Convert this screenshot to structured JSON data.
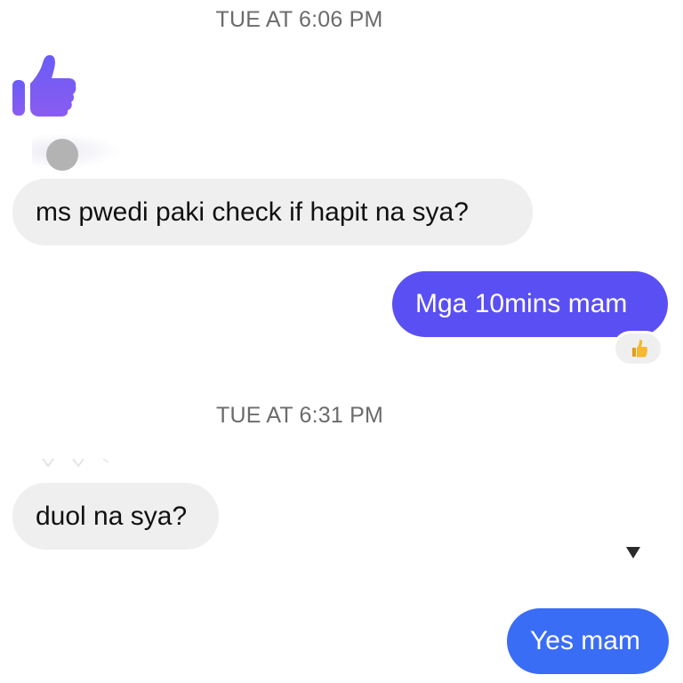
{
  "timestamps": {
    "first": "TUE AT 6:06 PM",
    "second": "TUE AT 6:31 PM"
  },
  "messages": [
    {
      "direction": "incoming",
      "text": "ms pwedi paki check if hapit na sya?"
    },
    {
      "direction": "outgoing",
      "text": "Mga 10mins mam"
    },
    {
      "direction": "incoming",
      "text": "duol na sya?"
    },
    {
      "direction": "outgoing",
      "text": "Yes mam"
    }
  ],
  "icons": {
    "big_like": "thumbs-up-icon",
    "reaction": "thumbs-up-emoji-icon",
    "seen": "seen-indicator-icon",
    "avatar": "avatar"
  },
  "colors": {
    "like": "#7b5cf5",
    "outgoing_purple": "#5a4ff3",
    "outgoing_blue": "#3a6df5",
    "incoming_bg": "#efefef",
    "timestamp": "#6b6b6b",
    "reaction_emoji": "#f5b82e"
  }
}
